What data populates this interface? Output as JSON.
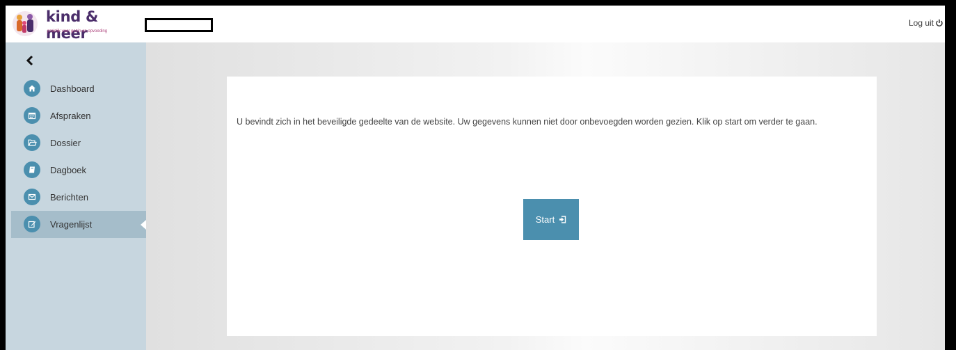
{
  "brand": {
    "name": "kind & meer",
    "tagline": "praktijk voor gezin en opvoeding",
    "colors": {
      "primary": "#4b8fae",
      "brand_purple": "#4a2d6a",
      "sidebar": "#c7d6df"
    }
  },
  "header": {
    "logout_label": "Log uit",
    "logout_icon": "power-icon"
  },
  "sidebar": {
    "collapse_icon": "chevron-left-icon",
    "items": [
      {
        "label": "Dashboard",
        "icon": "home-icon",
        "active": false
      },
      {
        "label": "Afspraken",
        "icon": "calendar-icon",
        "active": false
      },
      {
        "label": "Dossier",
        "icon": "folder-icon",
        "active": false
      },
      {
        "label": "Dagboek",
        "icon": "book-icon",
        "active": false
      },
      {
        "label": "Berichten",
        "icon": "envelope-icon",
        "active": false
      },
      {
        "label": "Vragenlijst",
        "icon": "edit-icon",
        "active": true
      }
    ]
  },
  "main": {
    "message": "U bevindt zich in het beveiligde gedeelte van de website. Uw gegevens kunnen niet door onbevoegden worden gezien. Klik op start om verder te gaan.",
    "start_label": "Start",
    "start_icon": "sign-in-icon"
  }
}
